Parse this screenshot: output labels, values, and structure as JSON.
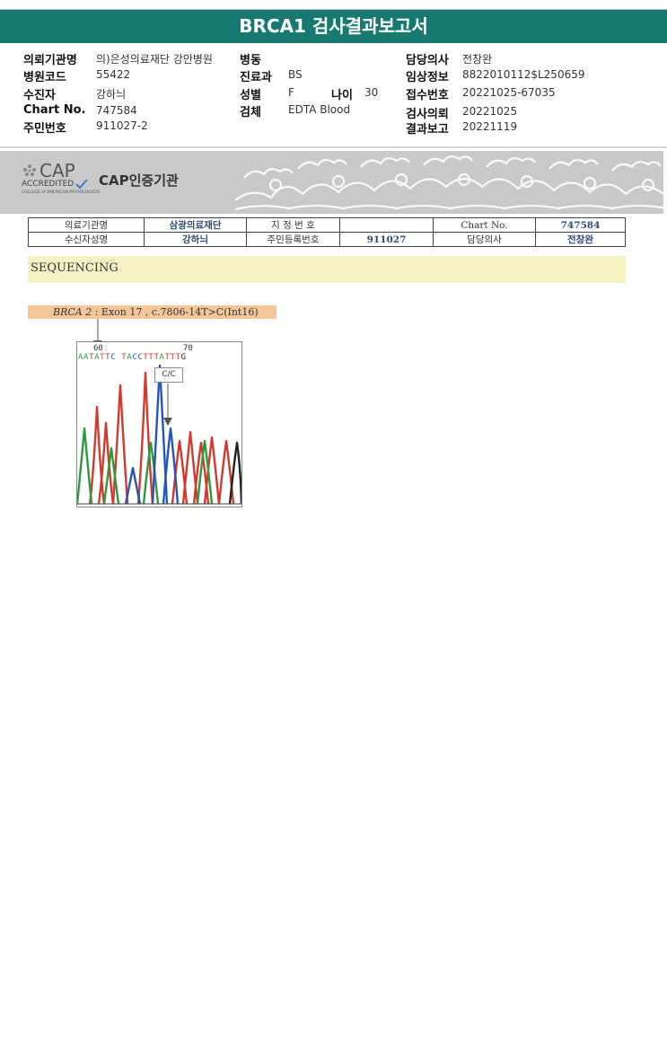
{
  "report": {
    "title": "BRCA1 검사결과보고서"
  },
  "header": {
    "col1": [
      {
        "label": "의뢰기관명",
        "value": "의)은성의료재단 강안병원"
      },
      {
        "label": "병원코드",
        "value": "55422"
      },
      {
        "label": "수진자",
        "value": "강하늬"
      },
      {
        "label": "Chart No.",
        "value": "747584"
      },
      {
        "label": "주민번호",
        "value": "911027-2"
      }
    ],
    "col2": [
      {
        "label": "병동",
        "value": ""
      },
      {
        "label": "진료과",
        "value": "BS"
      },
      {
        "label": "성별",
        "value": "F"
      },
      {
        "label": "검체",
        "value": "EDTA Blood"
      }
    ],
    "age": {
      "label": "나이",
      "value": "30"
    },
    "col3": [
      {
        "label": "담당의사",
        "value": "전창완"
      },
      {
        "label": "임상정보",
        "value": "8822010112$L250659"
      },
      {
        "label": "접수번호",
        "value": "20221025-67035"
      },
      {
        "label": "검사의뢰",
        "value": "20221025"
      },
      {
        "label": "결과보고",
        "value": "20221119"
      }
    ]
  },
  "cap": {
    "logo": "CAP",
    "accredited": "ACCREDITED",
    "college": "COLLEGE of AMERICAN PATHOLOGISTS",
    "cert": "CAP인증기관"
  },
  "patient_table": {
    "r1": [
      "의료기관명",
      "삼광의료재단",
      "지 정 번 호",
      "",
      "Chart No.",
      "747584"
    ],
    "r2": [
      "수신자성명",
      "강하늬",
      "주민등록번호",
      "911027",
      "담당의사",
      "전창완"
    ]
  },
  "sequencing": {
    "heading": "SEQUENCING",
    "gene": "BRCA 2",
    "variant": ": Exon 17 , c.7806-14T>C(Int16)",
    "pos_left": "60",
    "pos_right": "70",
    "bases": [
      {
        "b": "A",
        "c": "#2e9a3e"
      },
      {
        "b": "A",
        "c": "#2e9a3e"
      },
      {
        "b": "T",
        "c": "#d03a2f"
      },
      {
        "b": "A",
        "c": "#2e9a3e"
      },
      {
        "b": "T",
        "c": "#d03a2f"
      },
      {
        "b": "T",
        "c": "#d03a2f"
      },
      {
        "b": "C",
        "c": "#2356b8"
      },
      {
        "b": " ",
        "c": "#000"
      },
      {
        "b": "T",
        "c": "#d03a2f"
      },
      {
        "b": "A",
        "c": "#2e9a3e"
      },
      {
        "b": "C",
        "c": "#2356b8"
      },
      {
        "b": "C",
        "c": "#2356b8"
      },
      {
        "b": "T",
        "c": "#d03a2f"
      },
      {
        "b": "T",
        "c": "#d03a2f"
      },
      {
        "b": "T",
        "c": "#d03a2f"
      },
      {
        "b": "A",
        "c": "#2e9a3e"
      },
      {
        "b": "T",
        "c": "#d03a2f"
      },
      {
        "b": "T",
        "c": "#d03a2f"
      },
      {
        "b": "T",
        "c": "#d03a2f"
      },
      {
        "b": "G",
        "c": "#222"
      }
    ],
    "genotype": "C/C"
  }
}
